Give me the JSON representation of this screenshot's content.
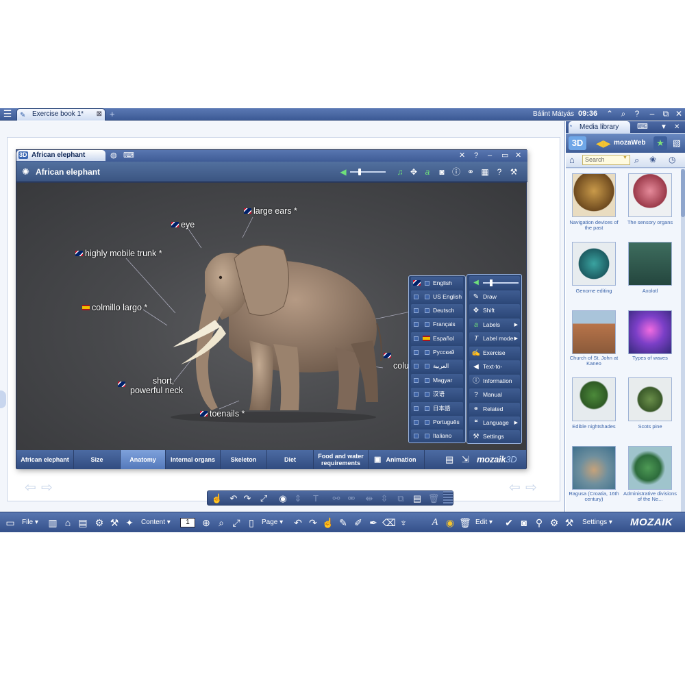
{
  "app": {
    "tab_title": "Exercise book 1*",
    "user_name": "Bálint Mátyás",
    "clock": "09:36"
  },
  "media_library": {
    "title": "Media library",
    "source": "mozaWeb",
    "search_placeholder": "Search",
    "items": [
      {
        "label": "Navigation devices of the past"
      },
      {
        "label": "The sensory organs"
      },
      {
        "label": "Genome editing"
      },
      {
        "label": "Axolotl"
      },
      {
        "label": "Church of St. John at Kaneo"
      },
      {
        "label": "Types of waves"
      },
      {
        "label": "Edible nightshades"
      },
      {
        "label": "Scots pine"
      },
      {
        "label": "Ragusa (Croatia, 16th century)"
      },
      {
        "label": "Administrative divisions of the Ne..."
      }
    ]
  },
  "window3d": {
    "tab_label": "African elephant",
    "badge": "3D",
    "title": "African elephant",
    "labels": {
      "large_ears": "large ears *",
      "eye": "eye",
      "trunk": "highly mobile trunk *",
      "tusk": "colmillo largo *",
      "neck_line1": "short,",
      "neck_line2": "powerful neck",
      "toenails": "toenails *",
      "partial": "colu"
    },
    "tabs": [
      {
        "label": "African elephant"
      },
      {
        "label": "Size"
      },
      {
        "label": "Anatomy"
      },
      {
        "label": "Internal organs"
      },
      {
        "label": "Skeleton"
      },
      {
        "label": "Diet"
      },
      {
        "label": "Food and water"
      },
      {
        "label": "requirements"
      },
      {
        "label": "Animation"
      }
    ],
    "active_tab": "Anatomy",
    "logo": "mozaik",
    "logo_suffix": "3D"
  },
  "language_menu": [
    {
      "label": "English"
    },
    {
      "label": "US English"
    },
    {
      "label": "Deutsch"
    },
    {
      "label": "Français"
    },
    {
      "label": "Español"
    },
    {
      "label": "Русский"
    },
    {
      "label": "العربية"
    },
    {
      "label": "Magyar"
    },
    {
      "label": "汉语"
    },
    {
      "label": "日本語"
    },
    {
      "label": "Português"
    },
    {
      "label": "Italiano"
    }
  ],
  "tool_menu": [
    {
      "label": "Draw"
    },
    {
      "label": "Shift"
    },
    {
      "label": "Labels"
    },
    {
      "label": "Label mode"
    },
    {
      "label": "Exercise"
    },
    {
      "label": "Text-to-speech"
    },
    {
      "label": "Information"
    },
    {
      "label": "Manual"
    },
    {
      "label": "Related"
    },
    {
      "label": "Language"
    },
    {
      "label": "Settings"
    }
  ],
  "bottom_toolbar": {
    "file": "File",
    "content": "Content",
    "page_number": "1",
    "page": "Page",
    "edit": "Edit",
    "settings": "Settings",
    "logo": "MOZAIK"
  }
}
